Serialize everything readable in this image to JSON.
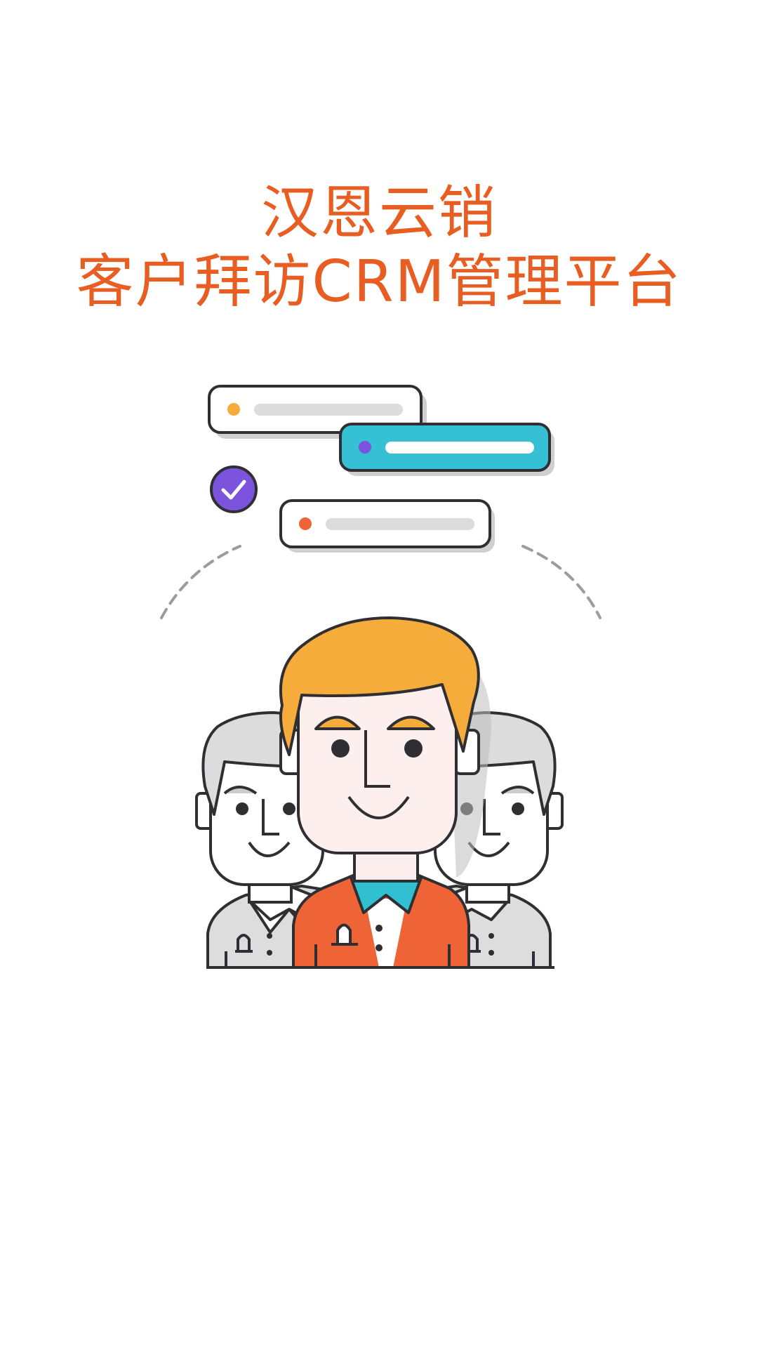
{
  "splash": {
    "title_line1": "汉恩云销",
    "title_line2": "客户拜访CRM管理平台",
    "colors": {
      "title": "#e85d22",
      "hair_main": "#f5ac3a",
      "shirt_main": "#ee6436",
      "collar": "#31bfd2",
      "check_badge": "#7b53dd",
      "card_accent": "#35c0d3",
      "outline": "#2f2f33",
      "skin_main": "#fdefed",
      "grey_figure": "#d9d9d9"
    },
    "icons": [
      "task-card-icon",
      "check-circle-icon",
      "team-people-icon"
    ]
  }
}
